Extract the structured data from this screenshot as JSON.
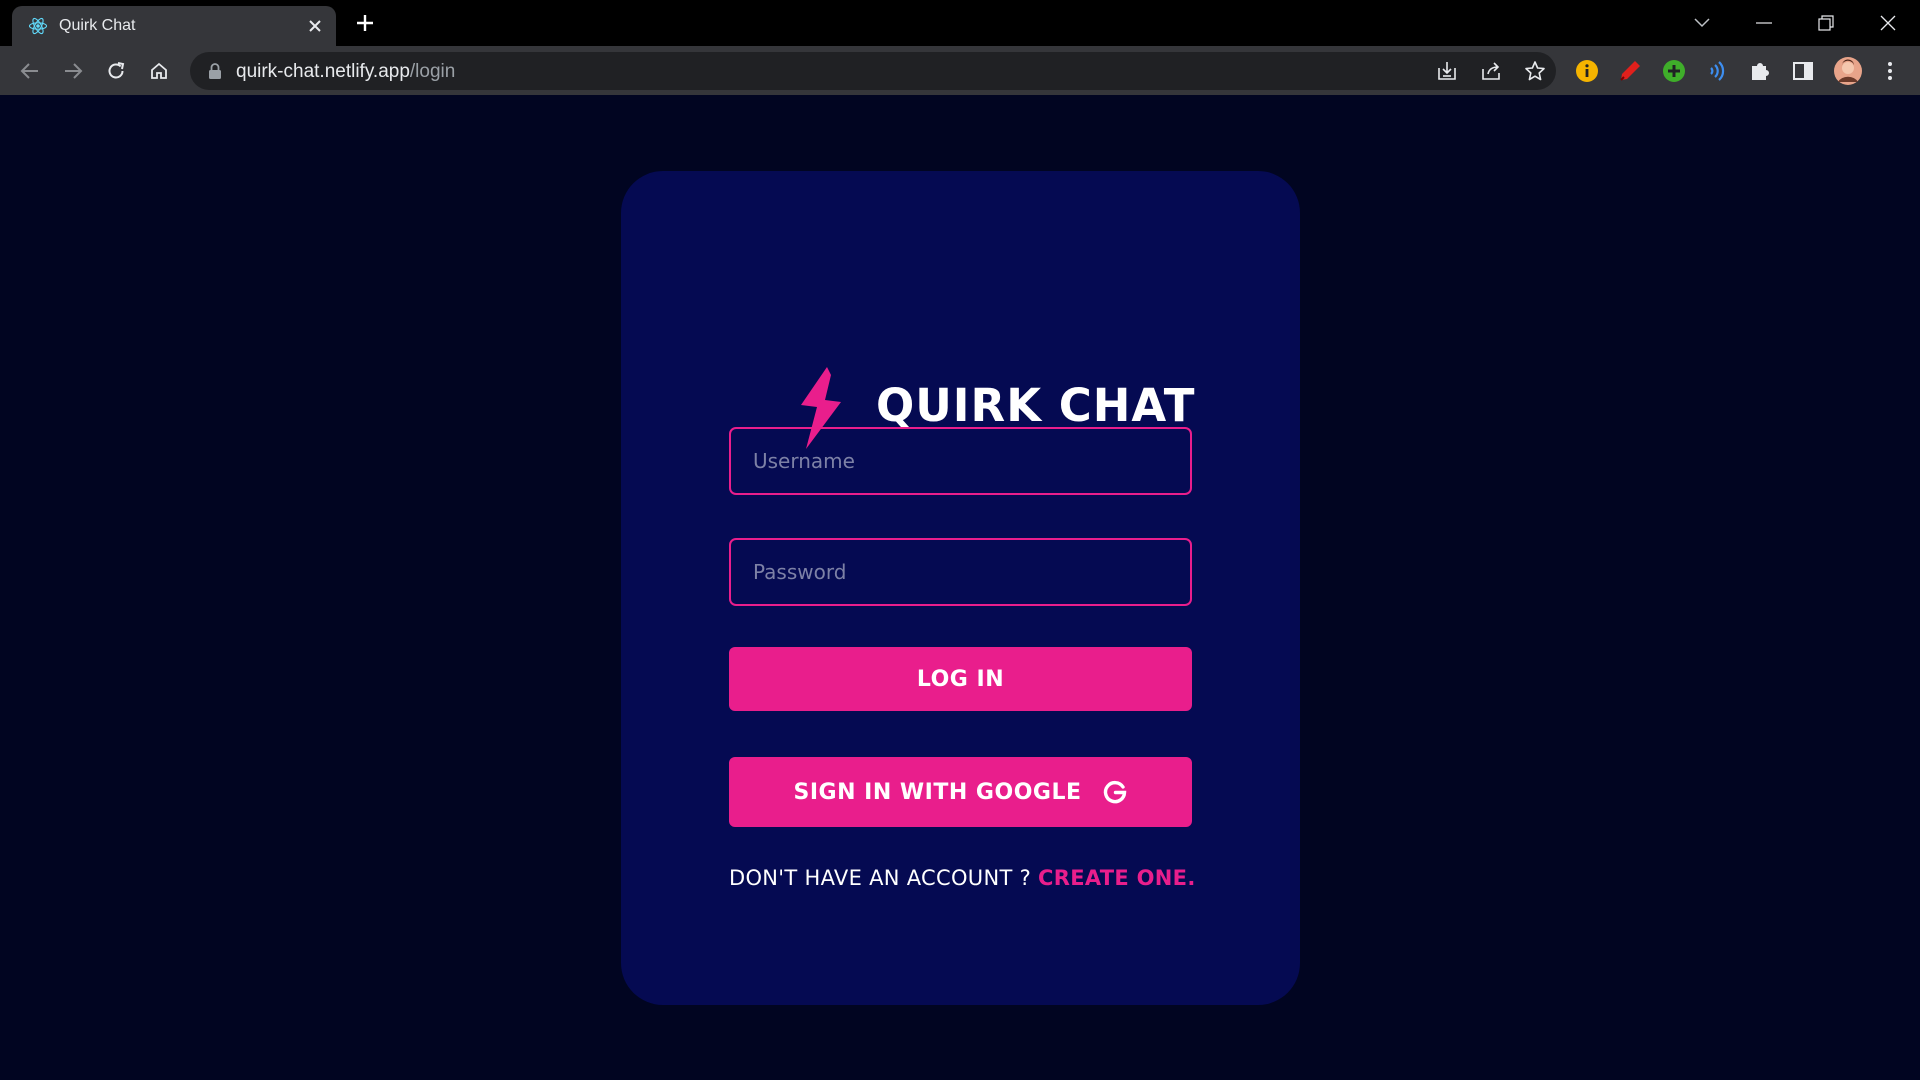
{
  "browser": {
    "tab_title": "Quirk Chat",
    "url_host": "quirk-chat.netlify.app",
    "url_path": "/login"
  },
  "app": {
    "brand_name": "QUIRK CHAT",
    "username_placeholder": "Username",
    "password_placeholder": "Password",
    "login_label": "LOG IN",
    "google_label": "SIGN IN WITH GOOGLE",
    "signup_prompt": "DON'T HAVE AN ACCOUNT ? ",
    "signup_link": "CREATE ONE."
  },
  "colors": {
    "accent": "#e91e8c",
    "page_bg": "#010521",
    "card_bg": "#050a52"
  },
  "icons": [
    "react-favicon-icon",
    "close-icon",
    "plus-icon",
    "chevron-down-icon",
    "minimize-icon",
    "restore-icon",
    "close-window-icon",
    "back-arrow-icon",
    "forward-arrow-icon",
    "reload-icon",
    "home-icon",
    "lock-icon",
    "install-icon",
    "share-icon",
    "star-icon",
    "lightning-bolt-icon",
    "google-g-icon"
  ]
}
